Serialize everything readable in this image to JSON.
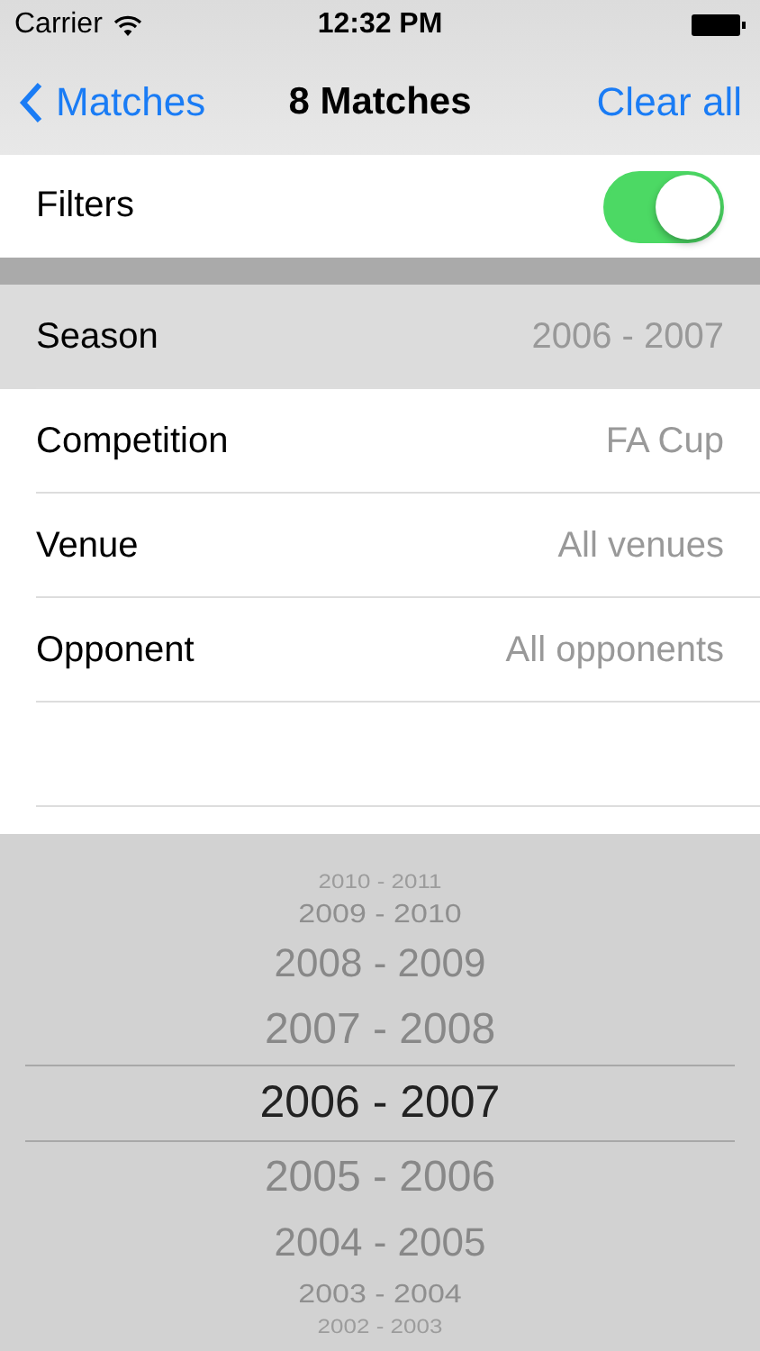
{
  "status_bar": {
    "carrier": "Carrier",
    "time": "12:32 PM"
  },
  "nav": {
    "back": "Matches",
    "title": "8 Matches",
    "action": "Clear all"
  },
  "filters": {
    "label": "Filters",
    "on": true
  },
  "rows": [
    {
      "label": "Season",
      "value": "2006 - 2007",
      "selected": true
    },
    {
      "label": "Competition",
      "value": "FA Cup",
      "selected": false
    },
    {
      "label": "Venue",
      "value": "All venues",
      "selected": false
    },
    {
      "label": "Opponent",
      "value": "All opponents",
      "selected": false
    }
  ],
  "picker": [
    {
      "label": "2010 - 2011",
      "selected": false
    },
    {
      "label": "2009 - 2010",
      "selected": false
    },
    {
      "label": "2008 - 2009",
      "selected": false
    },
    {
      "label": "2007 - 2008",
      "selected": false
    },
    {
      "label": "2006 - 2007",
      "selected": true
    },
    {
      "label": "2005 - 2006",
      "selected": false
    },
    {
      "label": "2004 - 2005",
      "selected": false
    },
    {
      "label": "2003 - 2004",
      "selected": false
    },
    {
      "label": "2002 - 2003",
      "selected": false
    }
  ]
}
